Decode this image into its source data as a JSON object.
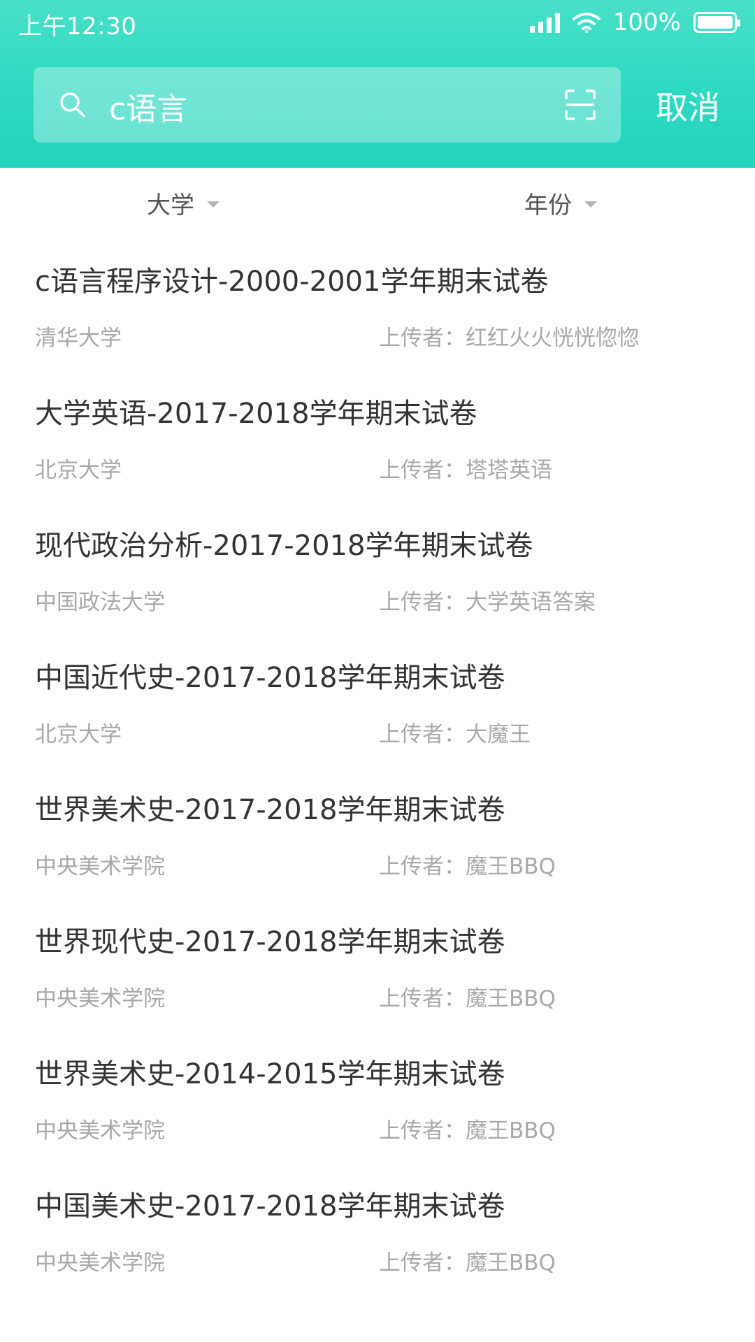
{
  "status_bar": {
    "time": "上午12:30",
    "battery": "100%"
  },
  "search": {
    "query": "c语言",
    "cancel_label": "取消"
  },
  "filters": {
    "university_label": "大学",
    "year_label": "年份"
  },
  "results": [
    {
      "title": "c语言程序设计-2000-2001学年期末试卷",
      "school": "清华大学",
      "uploader": "上传者：红红火火恍恍惚惚"
    },
    {
      "title": "大学英语-2017-2018学年期末试卷",
      "school": "北京大学",
      "uploader": "上传者：塔塔英语"
    },
    {
      "title": "现代政治分析-2017-2018学年期末试卷",
      "school": "中国政法大学",
      "uploader": "上传者：大学英语答案"
    },
    {
      "title": "中国近代史-2017-2018学年期末试卷",
      "school": "北京大学",
      "uploader": "上传者：大魔王"
    },
    {
      "title": "世界美术史-2017-2018学年期末试卷",
      "school": "中央美术学院",
      "uploader": "上传者：魔王BBQ"
    },
    {
      "title": "世界现代史-2017-2018学年期末试卷",
      "school": "中央美术学院",
      "uploader": "上传者：魔王BBQ"
    },
    {
      "title": "世界美术史-2014-2015学年期末试卷",
      "school": "中央美术学院",
      "uploader": "上传者：魔王BBQ"
    },
    {
      "title": "中国美术史-2017-2018学年期末试卷",
      "school": "中央美术学院",
      "uploader": "上传者：魔王BBQ"
    }
  ],
  "colors": {
    "header_start": "#48e0c8",
    "header_end": "#22d3bd",
    "title_text": "#333333",
    "meta_text": "#a9a9a9"
  },
  "icons": [
    "signal-icon",
    "wifi-icon",
    "battery-icon",
    "search-icon",
    "scan-icon",
    "caret-down-icon"
  ]
}
